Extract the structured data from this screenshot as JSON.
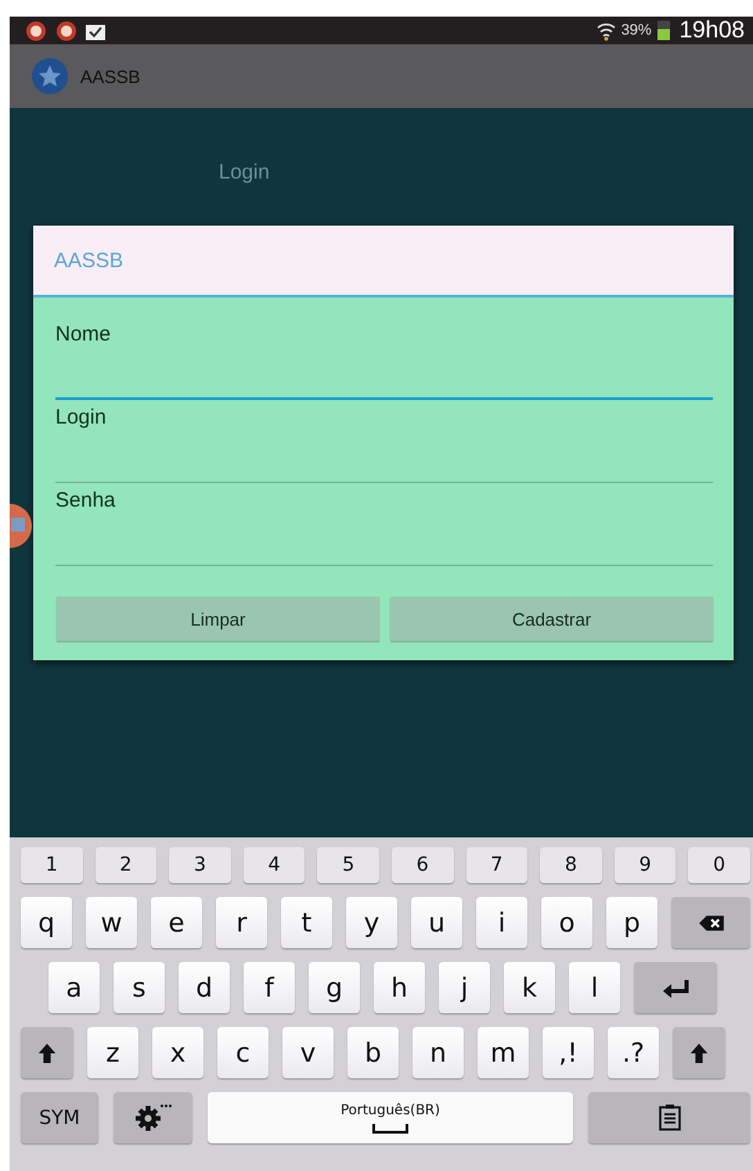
{
  "status_bar": {
    "battery": "39%",
    "time": "19h08"
  },
  "app_bar": {
    "title": "AASSB"
  },
  "page_label": "Login",
  "dialog": {
    "title": "AASSB",
    "fields": [
      {
        "label": "Nome",
        "focused": true
      },
      {
        "label": "Login",
        "focused": false
      },
      {
        "label": "Senha",
        "focused": false
      }
    ],
    "buttons": [
      "Limpar",
      "Cadastrar"
    ]
  },
  "keyboard": {
    "rows": [
      {
        "keys": [
          {
            "kind": "num",
            "label": "1"
          },
          {
            "kind": "num",
            "label": "2"
          },
          {
            "kind": "num",
            "label": "3"
          },
          {
            "kind": "num",
            "label": "4"
          },
          {
            "kind": "num",
            "label": "5"
          },
          {
            "kind": "num",
            "label": "6"
          },
          {
            "kind": "num",
            "label": "7"
          },
          {
            "kind": "num",
            "label": "8"
          },
          {
            "kind": "num",
            "label": "9"
          },
          {
            "kind": "num",
            "label": "0"
          }
        ]
      },
      {
        "keys": [
          {
            "kind": "char",
            "label": "q"
          },
          {
            "kind": "char",
            "label": "w"
          },
          {
            "kind": "char",
            "label": "e"
          },
          {
            "kind": "char",
            "label": "r"
          },
          {
            "kind": "char",
            "label": "t"
          },
          {
            "kind": "char",
            "label": "y"
          },
          {
            "kind": "char",
            "label": "u"
          },
          {
            "kind": "char",
            "label": "i"
          },
          {
            "kind": "char",
            "label": "o"
          },
          {
            "kind": "char",
            "label": "p"
          },
          {
            "kind": "backspace"
          }
        ]
      },
      {
        "keys": [
          {
            "kind": "char",
            "label": "a"
          },
          {
            "kind": "char",
            "label": "s"
          },
          {
            "kind": "char",
            "label": "d"
          },
          {
            "kind": "char",
            "label": "f"
          },
          {
            "kind": "char",
            "label": "g"
          },
          {
            "kind": "char",
            "label": "h"
          },
          {
            "kind": "char",
            "label": "j"
          },
          {
            "kind": "char",
            "label": "k"
          },
          {
            "kind": "char",
            "label": "l"
          },
          {
            "kind": "enter"
          }
        ]
      },
      {
        "keys": [
          {
            "kind": "shift"
          },
          {
            "kind": "char",
            "label": "z"
          },
          {
            "kind": "char",
            "label": "x"
          },
          {
            "kind": "char",
            "label": "c"
          },
          {
            "kind": "char",
            "label": "v"
          },
          {
            "kind": "char",
            "label": "b"
          },
          {
            "kind": "char",
            "label": "n"
          },
          {
            "kind": "char",
            "label": "m"
          },
          {
            "kind": "char",
            "label": ",!"
          },
          {
            "kind": "char",
            "label": ".?"
          },
          {
            "kind": "shift"
          }
        ]
      },
      {
        "keys": [
          {
            "kind": "mode",
            "label": "SYM"
          },
          {
            "kind": "settings"
          },
          {
            "kind": "space",
            "label": "Português(BR)"
          },
          {
            "kind": "clipboard"
          }
        ]
      }
    ]
  }
}
